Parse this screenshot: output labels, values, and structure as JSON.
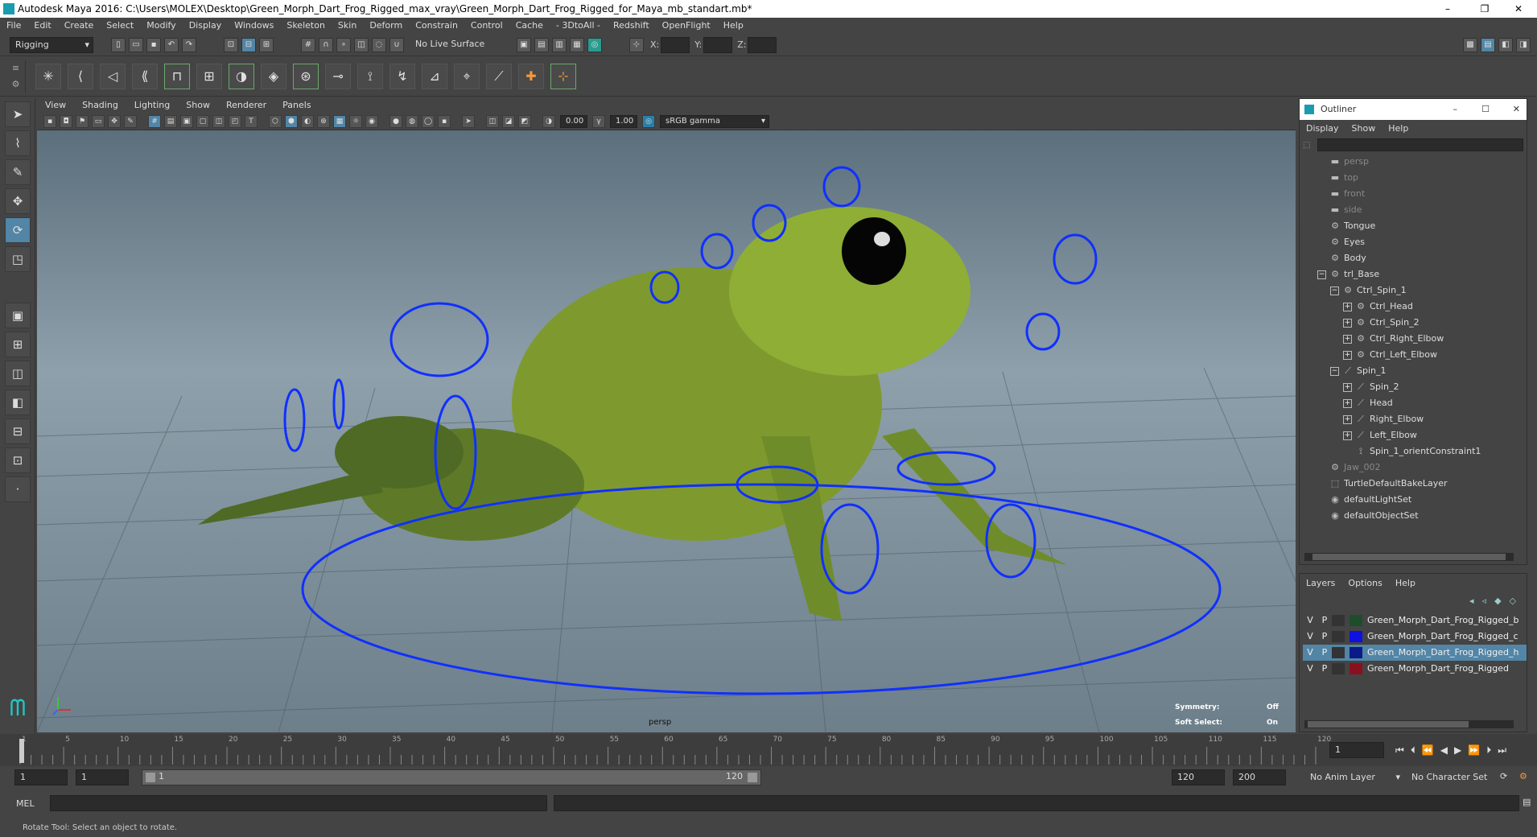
{
  "window": {
    "title": "Autodesk Maya 2016: C:\\Users\\MOLEX\\Desktop\\Green_Morph_Dart_Frog_Rigged_max_vray\\Green_Morph_Dart_Frog_Rigged_for_Maya_mb_standart.mb*",
    "minimize_glyph": "–",
    "restore_glyph": "❐",
    "close_glyph": "✕"
  },
  "menubar": [
    "File",
    "Edit",
    "Create",
    "Select",
    "Modify",
    "Display",
    "Windows",
    "Skeleton",
    "Skin",
    "Deform",
    "Constrain",
    "Control",
    "Cache",
    "- 3DtoAll -",
    "Redshift",
    "OpenFlight",
    "Help"
  ],
  "statusline": {
    "menuset": "Rigging",
    "live_surface": "No Live Surface",
    "x_label": "X:",
    "y_label": "Y:",
    "z_label": "Z:"
  },
  "viewport": {
    "menus": [
      "View",
      "Shading",
      "Lighting",
      "Show",
      "Renderer",
      "Panels"
    ],
    "exposure": "0.00",
    "gamma": "1.00",
    "color_space": "sRGB gamma",
    "camera_label": "persp",
    "symmetry_label": "Symmetry:",
    "symmetry_value": "Off",
    "soft_select_label": "Soft Select:",
    "soft_select_value": "On"
  },
  "outliner": {
    "title": "Outliner",
    "menus": [
      "Display",
      "Show",
      "Help"
    ],
    "items": [
      {
        "label": "persp",
        "icon": "camera-icon",
        "depth": 0,
        "dim": true,
        "toggle": ""
      },
      {
        "label": "top",
        "icon": "camera-icon",
        "depth": 0,
        "dim": true,
        "toggle": ""
      },
      {
        "label": "front",
        "icon": "camera-icon",
        "depth": 0,
        "dim": true,
        "toggle": ""
      },
      {
        "label": "side",
        "icon": "camera-icon",
        "depth": 0,
        "dim": true,
        "toggle": ""
      },
      {
        "label": "Tongue",
        "icon": "transform-icon",
        "depth": 0,
        "dim": false,
        "toggle": ""
      },
      {
        "label": "Eyes",
        "icon": "transform-icon",
        "depth": 0,
        "dim": false,
        "toggle": ""
      },
      {
        "label": "Body",
        "icon": "transform-icon",
        "depth": 0,
        "dim": false,
        "toggle": ""
      },
      {
        "label": "trl_Base",
        "icon": "transform-icon",
        "depth": 0,
        "dim": false,
        "toggle": "−"
      },
      {
        "label": "Ctrl_Spin_1",
        "icon": "transform-icon",
        "depth": 1,
        "dim": false,
        "toggle": "−"
      },
      {
        "label": "Ctrl_Head",
        "icon": "transform-icon",
        "depth": 2,
        "dim": false,
        "toggle": "+"
      },
      {
        "label": "Ctrl_Spin_2",
        "icon": "transform-icon",
        "depth": 2,
        "dim": false,
        "toggle": "+"
      },
      {
        "label": "Ctrl_Right_Elbow",
        "icon": "transform-icon",
        "depth": 2,
        "dim": false,
        "toggle": "+"
      },
      {
        "label": "Ctrl_Left_Elbow",
        "icon": "transform-icon",
        "depth": 2,
        "dim": false,
        "toggle": "+"
      },
      {
        "label": "Spin_1",
        "icon": "joint-icon",
        "depth": 1,
        "dim": false,
        "toggle": "−"
      },
      {
        "label": "Spin_2",
        "icon": "joint-icon",
        "depth": 2,
        "dim": false,
        "toggle": "+"
      },
      {
        "label": "Head",
        "icon": "joint-icon",
        "depth": 2,
        "dim": false,
        "toggle": "+"
      },
      {
        "label": "Right_Elbow",
        "icon": "joint-icon",
        "depth": 2,
        "dim": false,
        "toggle": "+"
      },
      {
        "label": "Left_Elbow",
        "icon": "joint-icon",
        "depth": 2,
        "dim": false,
        "toggle": "+"
      },
      {
        "label": "Spin_1_orientConstraint1",
        "icon": "constraint-icon",
        "depth": 2,
        "dim": false,
        "toggle": ""
      },
      {
        "label": "Jaw_002",
        "icon": "transform-icon",
        "depth": 0,
        "dim": true,
        "toggle": ""
      },
      {
        "label": "TurtleDefaultBakeLayer",
        "icon": "bake-layer-icon",
        "depth": 0,
        "dim": false,
        "toggle": ""
      },
      {
        "label": "defaultLightSet",
        "icon": "set-icon",
        "depth": 0,
        "dim": false,
        "toggle": ""
      },
      {
        "label": "defaultObjectSet",
        "icon": "set-icon",
        "depth": 0,
        "dim": false,
        "toggle": ""
      }
    ]
  },
  "layers": {
    "menus": [
      "Layers",
      "Options",
      "Help"
    ],
    "rows": [
      {
        "v": "V",
        "p": "P",
        "color": "#1e4d2b",
        "name": "Green_Morph_Dart_Frog_Rigged_b",
        "selected": false
      },
      {
        "v": "V",
        "p": "P",
        "color": "#1010e0",
        "name": "Green_Morph_Dart_Frog_Rigged_c",
        "selected": false
      },
      {
        "v": "V",
        "p": "P",
        "color": "#0a1a8a",
        "name": "Green_Morph_Dart_Frog_Rigged_h",
        "selected": true
      },
      {
        "v": "V",
        "p": "P",
        "color": "#8a1020",
        "name": "Green_Morph_Dart_Frog_Rigged",
        "selected": false
      }
    ]
  },
  "timeline": {
    "ticks": [
      "1",
      "5",
      "10",
      "15",
      "20",
      "25",
      "30",
      "35",
      "40",
      "45",
      "50",
      "55",
      "60",
      "65",
      "70",
      "75",
      "80",
      "85",
      "90",
      "95",
      "100",
      "105",
      "110",
      "115",
      "120"
    ],
    "current_frame": "1"
  },
  "rangebar": {
    "start": "1",
    "playback_start": "1",
    "slider_start": "1",
    "slider_end": "120",
    "playback_end": "120",
    "end": "200",
    "anim_layer": "No Anim Layer",
    "character_set": "No Character Set"
  },
  "cmdline": {
    "label": "MEL"
  },
  "helpline": {
    "text": "Rotate Tool: Select an object to rotate."
  }
}
